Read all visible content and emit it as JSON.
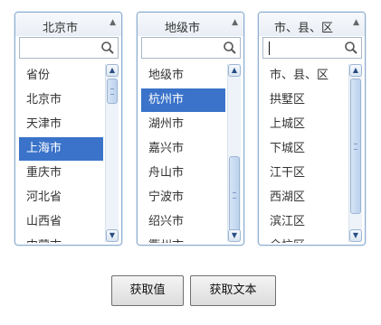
{
  "province_select": {
    "title": "北京市",
    "search_value": "",
    "items": [
      "省份",
      "北京市",
      "天津市",
      "上海市",
      "重庆市",
      "河北省",
      "山西省",
      "内蒙古"
    ],
    "selected": "上海市"
  },
  "city_select": {
    "title": "地级市",
    "search_value": "",
    "items": [
      "地级市",
      "杭州市",
      "湖州市",
      "嘉兴市",
      "舟山市",
      "宁波市",
      "绍兴市",
      "衢州市"
    ],
    "selected": "杭州市"
  },
  "district_select": {
    "title": "市、县、区",
    "search_value": "",
    "items": [
      "市、县、区",
      "拱墅区",
      "上城区",
      "下城区",
      "江干区",
      "西湖区",
      "滨江区",
      "余杭区"
    ],
    "selected": null
  },
  "buttons": {
    "get_value": "获取值",
    "get_text": "获取文本"
  },
  "icons": {
    "search": "search-icon",
    "scroll_up": "chevron-up-icon",
    "scroll_down": "chevron-down-icon",
    "collapse": "caret-up-icon"
  },
  "colors": {
    "selection": "#3a73c9",
    "border": "#8eaed0"
  }
}
